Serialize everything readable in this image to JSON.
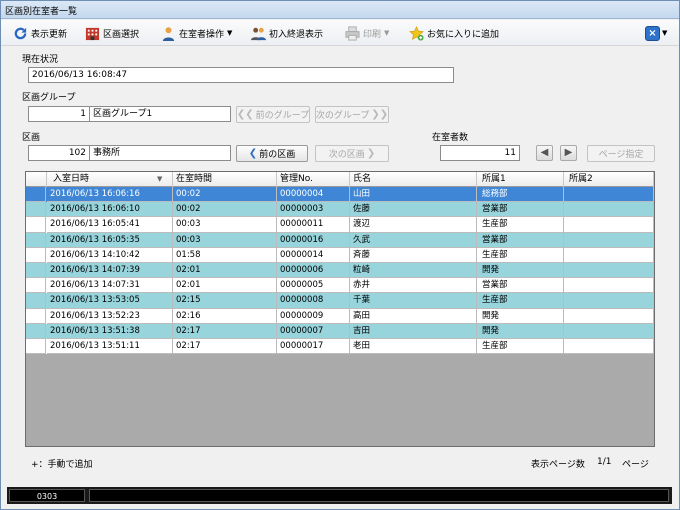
{
  "window": {
    "title": "区画別在室者一覧"
  },
  "toolbar": {
    "refresh": "表示更新",
    "area_select": "区画選択",
    "occupant_ops": "在室者操作",
    "first_entry_last_exit": "初入終退表示",
    "print": "印刷",
    "favorites_add": "お気に入りに追加"
  },
  "current_status": {
    "label": "現在状況",
    "value": "2016/06/13 16:08:47"
  },
  "area_group": {
    "label": "区画グループ",
    "number": "1",
    "name": "区画グループ1",
    "prev_label": "前のグループ",
    "next_label": "次のグループ"
  },
  "area": {
    "label": "区画",
    "number": "102",
    "name": "事務所",
    "prev_label": "前の区画",
    "next_label": "次の区画"
  },
  "occupants": {
    "label": "在室者数",
    "count": "11",
    "page_label": "ページ指定"
  },
  "table": {
    "columns": [
      "入室日時",
      "在室時間",
      "管理No.",
      "氏名",
      "所属1",
      "所属2"
    ],
    "rows": [
      {
        "entry": "2016/06/13 16:06:16",
        "duration": "00:02",
        "no": "00000004",
        "name": "山田",
        "dept1": "総務部",
        "dept2": "",
        "style": "sel"
      },
      {
        "entry": "2016/06/13 16:06:10",
        "duration": "00:02",
        "no": "00000003",
        "name": "佐藤",
        "dept1": "営業部",
        "dept2": "",
        "style": "cyan"
      },
      {
        "entry": "2016/06/13 16:05:41",
        "duration": "00:03",
        "no": "00000011",
        "name": "渡辺",
        "dept1": "生産部",
        "dept2": "",
        "style": "white"
      },
      {
        "entry": "2016/06/13 16:05:35",
        "duration": "00:03",
        "no": "00000016",
        "name": "久武",
        "dept1": "営業部",
        "dept2": "",
        "style": "cyan"
      },
      {
        "entry": "2016/06/13 14:10:42",
        "duration": "01:58",
        "no": "00000014",
        "name": "斉藤",
        "dept1": "生産部",
        "dept2": "",
        "style": "white"
      },
      {
        "entry": "2016/06/13 14:07:39",
        "duration": "02:01",
        "no": "00000006",
        "name": "粒崎",
        "dept1": "開発",
        "dept2": "",
        "style": "cyan"
      },
      {
        "entry": "2016/06/13 14:07:31",
        "duration": "02:01",
        "no": "00000005",
        "name": "赤井",
        "dept1": "営業部",
        "dept2": "",
        "style": "white"
      },
      {
        "entry": "2016/06/13 13:53:05",
        "duration": "02:15",
        "no": "00000008",
        "name": "千葉",
        "dept1": "生産部",
        "dept2": "",
        "style": "cyan"
      },
      {
        "entry": "2016/06/13 13:52:23",
        "duration": "02:16",
        "no": "00000009",
        "name": "高田",
        "dept1": "開発",
        "dept2": "",
        "style": "white"
      },
      {
        "entry": "2016/06/13 13:51:38",
        "duration": "02:17",
        "no": "00000007",
        "name": "吉田",
        "dept1": "開発",
        "dept2": "",
        "style": "cyan"
      },
      {
        "entry": "2016/06/13 13:51:11",
        "duration": "02:17",
        "no": "00000017",
        "name": "老田",
        "dept1": "生産部",
        "dept2": "",
        "style": "white"
      }
    ]
  },
  "footer": {
    "manual_add": "+：手動で追加",
    "page_count_label": "表示ページ数",
    "page_value": "1/1",
    "page_unit": "ページ"
  },
  "status_bar": {
    "code": "0303"
  },
  "colors": {
    "selected_row": "#3f86d6",
    "alt_row": "#98d4dc",
    "empty_grid": "#aaaaaa"
  }
}
